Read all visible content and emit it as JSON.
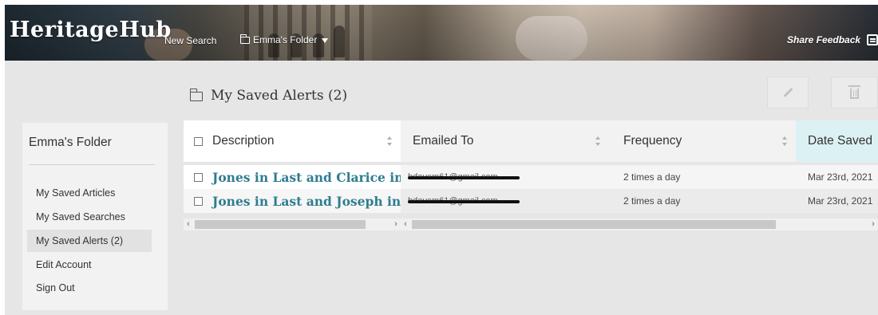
{
  "header": {
    "logo": "HeritageHub",
    "new_search": "New Search",
    "folder_menu": "Emma's Folder",
    "share_feedback": "Share Feedback"
  },
  "page": {
    "title": "My Saved Alerts (2)"
  },
  "sidebar": {
    "title": "Emma's Folder",
    "items": [
      {
        "label": "My Saved Articles"
      },
      {
        "label": "My Saved Searches"
      },
      {
        "label": "My Saved Alerts (2)"
      },
      {
        "label": "Edit Account"
      },
      {
        "label": "Sign Out"
      }
    ]
  },
  "table": {
    "columns": {
      "description": "Description",
      "emailed_to": "Emailed To",
      "frequency": "Frequency",
      "date_saved": "Date Saved"
    },
    "rows": [
      {
        "description": "Jones in Last and Clarice in Last",
        "email": "bdavem61@gmail.com",
        "frequency": "2 times a day",
        "date": "Mar 23rd, 2021"
      },
      {
        "description": "Jones in Last and Joseph in First",
        "email": "bdavem61@gmail.com",
        "frequency": "2 times a day",
        "date": "Mar 23rd, 2021"
      }
    ]
  },
  "icons": {
    "folder": "folder-icon",
    "caret": "caret-down-icon",
    "feedback": "feedback-icon",
    "edit": "pencil-icon",
    "delete": "trash-icon",
    "sort": "sort-icon",
    "checkbox": "checkbox-icon"
  },
  "colors": {
    "link": "#2f7d8f",
    "active_column": "#dcf1f3",
    "background": "#e6e6e6"
  }
}
